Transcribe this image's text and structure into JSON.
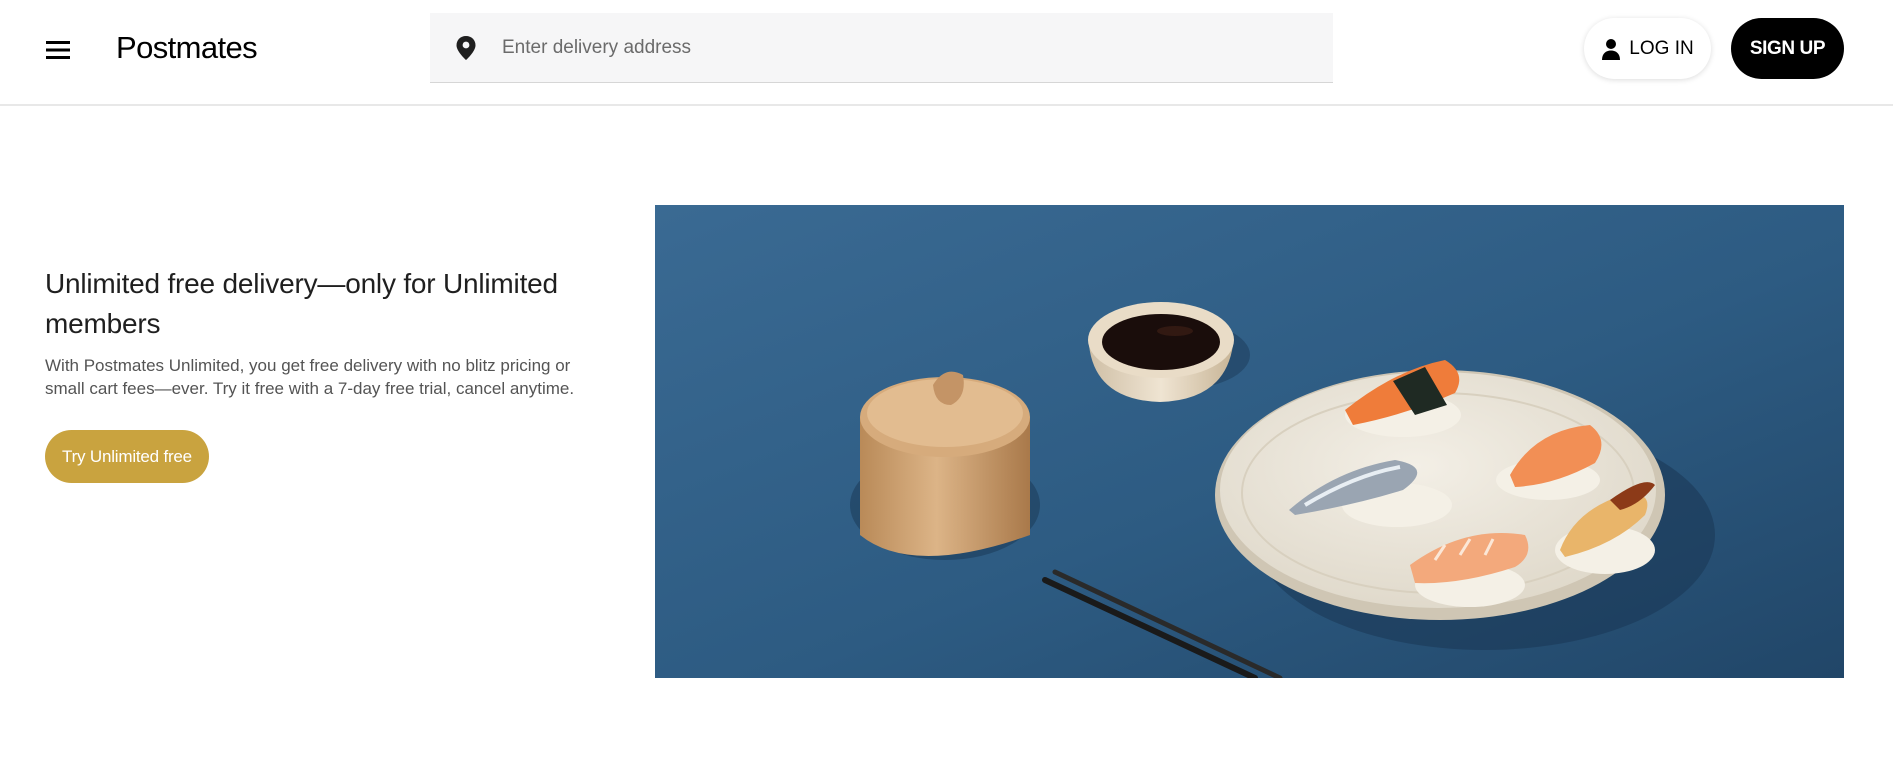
{
  "header": {
    "logo": "Postmates",
    "search_placeholder": "Enter delivery address",
    "login_label": "LOG IN",
    "signup_label": "SIGN UP"
  },
  "promo": {
    "title": "Unlimited free delivery—only for Unlimited members",
    "description": "With Postmates Unlimited, you get free delivery with no blitz pricing or small cart fees—ever. Try it free with a 7-day free trial, cancel anytime.",
    "cta_label": "Try Unlimited free"
  },
  "icons": {
    "menu": "hamburger-menu-icon",
    "search": "location-pin-icon",
    "login": "user-icon"
  },
  "colors": {
    "accent": "#c9a33f",
    "signup_bg": "#000000",
    "hero_bg": "#2e5a80"
  }
}
